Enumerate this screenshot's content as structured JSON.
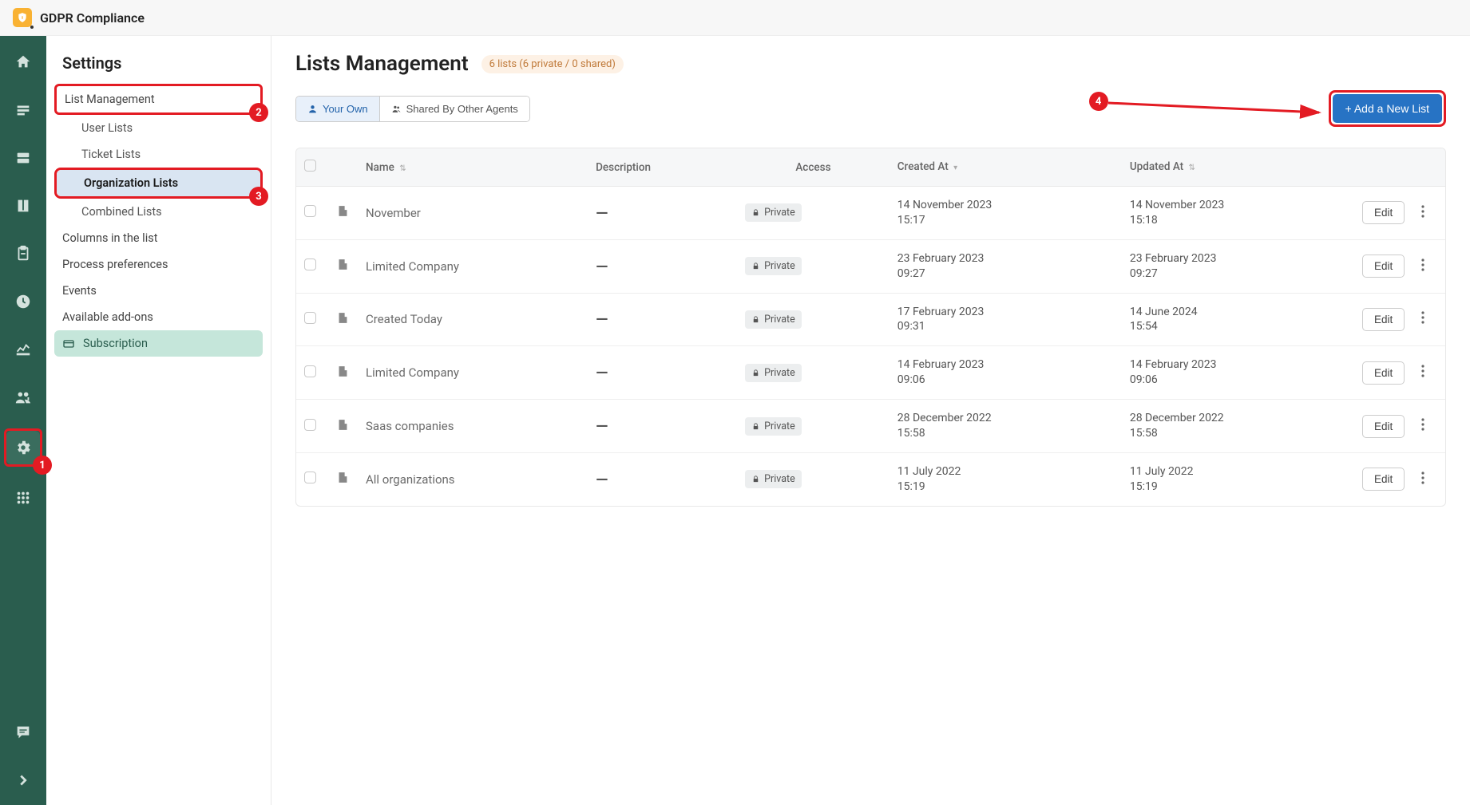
{
  "app": {
    "title": "GDPR Compliance"
  },
  "sidebar": {
    "title": "Settings",
    "items": {
      "list_management": "List Management",
      "user_lists": "User Lists",
      "ticket_lists": "Ticket Lists",
      "org_lists": "Organization Lists",
      "combined_lists": "Combined Lists",
      "columns": "Columns in the list",
      "process_prefs": "Process preferences",
      "events": "Events",
      "addons": "Available add-ons",
      "subscription": "Subscription"
    }
  },
  "page": {
    "title": "Lists Management",
    "count_badge": "6 lists (6 private / 0 shared)"
  },
  "segmented": {
    "own": "Your Own",
    "shared": "Shared By Other Agents"
  },
  "buttons": {
    "add_new": "+ Add a New List",
    "edit": "Edit"
  },
  "columns": {
    "name": "Name",
    "description": "Description",
    "access": "Access",
    "created": "Created At",
    "updated": "Updated At"
  },
  "access": {
    "private": "Private"
  },
  "rows": [
    {
      "name": "November",
      "desc": "—",
      "created": "14 November 2023 15:17",
      "updated": "14 November 2023 15:18"
    },
    {
      "name": "Limited Company",
      "desc": "—",
      "created": "23 February 2023 09:27",
      "updated": "23 February 2023 09:27"
    },
    {
      "name": "Created Today",
      "desc": "—",
      "created": "17 February 2023 09:31",
      "updated": "14 June 2024 15:54"
    },
    {
      "name": "Limited Company",
      "desc": "—",
      "created": "14 February 2023 09:06",
      "updated": "14 February 2023 09:06"
    },
    {
      "name": "Saas companies",
      "desc": "—",
      "created": "28 December 2022 15:58",
      "updated": "28 December 2022 15:58"
    },
    {
      "name": "All organizations",
      "desc": "—",
      "created": "11 July 2022 15:19",
      "updated": "11 July 2022 15:19"
    }
  ],
  "annotations": {
    "n1": "1",
    "n2": "2",
    "n3": "3",
    "n4": "4"
  }
}
